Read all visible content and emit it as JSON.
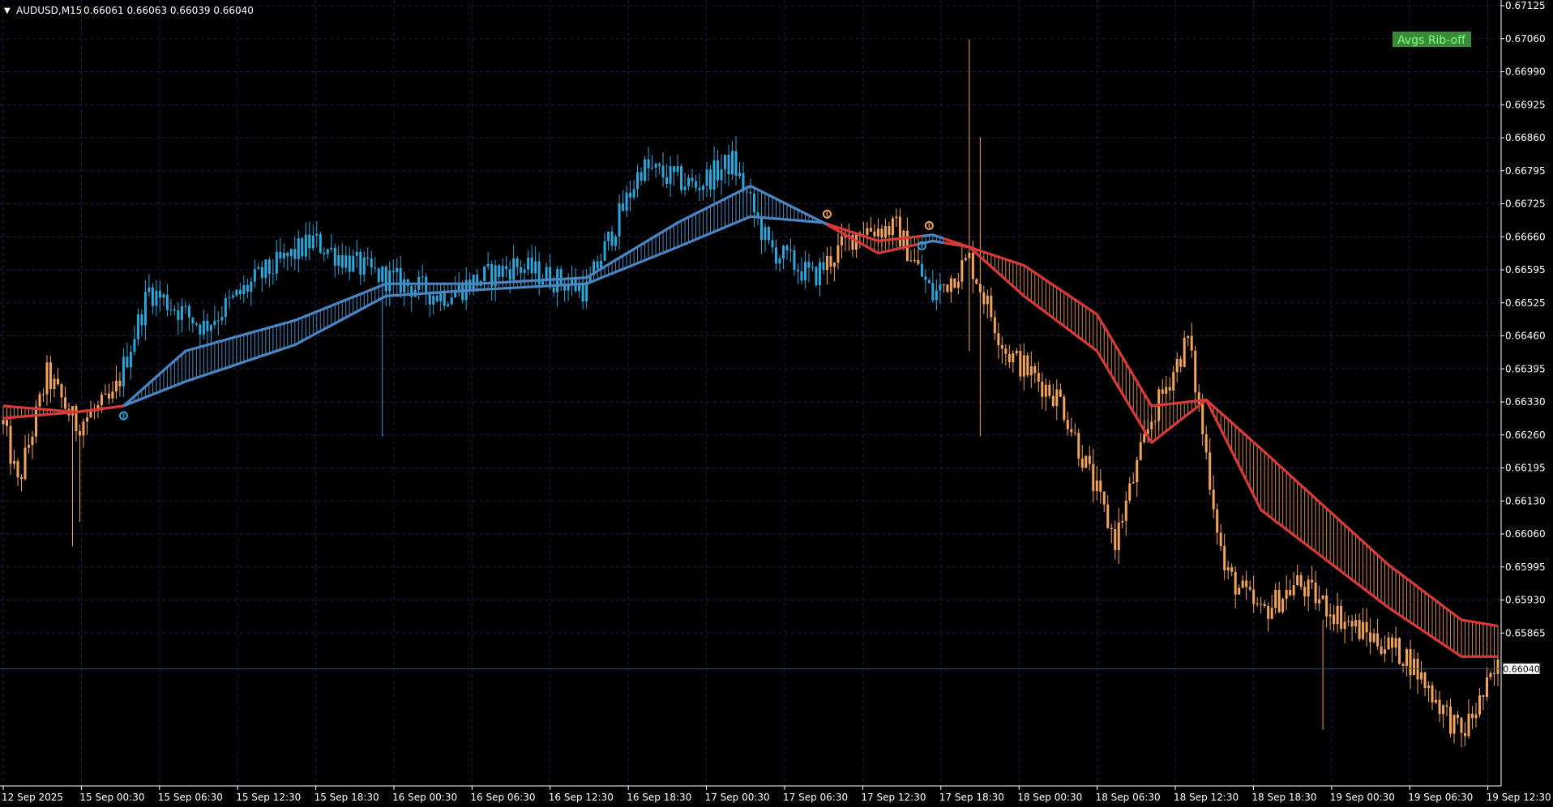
{
  "header": {
    "symbol_label": "AUDUSD,M15",
    "ohlc_label": "0.66061 0.66063 0.66039 0.66040"
  },
  "button": {
    "label": "Avgs Rib-off"
  },
  "colors": {
    "background": "#000000",
    "grid": "#1c1c4f",
    "axis": "#ffffff",
    "up": "#2ca7dc",
    "down": "#f2a45a",
    "ma_up": "#4a86c4",
    "ma_down": "#d83a3a",
    "ribbon_up": "#5aa0d6",
    "ribbon_down": "#f0a060",
    "button_bg": "#3a8a3a",
    "button_fg": "#80ff80"
  },
  "chart_data": {
    "type": "line",
    "title": "AUDUSD,M15",
    "ylim": [
      0.65835,
      0.67125
    ],
    "y_ticks": [
      "0.67125",
      "0.67060",
      "0.66990",
      "0.66925",
      "0.66860",
      "0.66795",
      "0.66725",
      "0.66660",
      "0.66595",
      "0.66525",
      "0.66460",
      "0.66395",
      "0.66330",
      "0.66260",
      "0.66195",
      "0.66130",
      "0.66060",
      "0.65995",
      "0.65930",
      "0.65865"
    ],
    "x_ticks": [
      "12 Sep 2025",
      "15 Sep 00:30",
      "15 Sep 06:30",
      "15 Sep 12:30",
      "15 Sep 18:30",
      "16 Sep 00:30",
      "16 Sep 06:30",
      "16 Sep 12:30",
      "16 Sep 18:30",
      "17 Sep 00:30",
      "17 Sep 06:30",
      "17 Sep 12:30",
      "17 Sep 18:30",
      "18 Sep 00:30",
      "18 Sep 06:30",
      "18 Sep 12:30",
      "18 Sep 18:30",
      "19 Sep 00:30",
      "19 Sep 06:30",
      "19 Sep 12:30"
    ],
    "current_price": "0.66040",
    "price_path": [
      {
        "bar": 0,
        "p": 0.6644
      },
      {
        "bar": 4,
        "p": 0.6634
      },
      {
        "bar": 12,
        "p": 0.6652
      },
      {
        "bar": 20,
        "p": 0.6644
      },
      {
        "bar": 30,
        "p": 0.6648
      },
      {
        "bar": 40,
        "p": 0.6666
      },
      {
        "bar": 55,
        "p": 0.666
      },
      {
        "bar": 70,
        "p": 0.6668
      },
      {
        "bar": 85,
        "p": 0.6674
      },
      {
        "bar": 100,
        "p": 0.6669
      },
      {
        "bar": 120,
        "p": 0.6665
      },
      {
        "bar": 140,
        "p": 0.667
      },
      {
        "bar": 160,
        "p": 0.6666
      },
      {
        "bar": 175,
        "p": 0.6686
      },
      {
        "bar": 190,
        "p": 0.6683
      },
      {
        "bar": 200,
        "p": 0.6687
      },
      {
        "bar": 210,
        "p": 0.6673
      },
      {
        "bar": 222,
        "p": 0.6668
      },
      {
        "bar": 235,
        "p": 0.6676
      },
      {
        "bar": 245,
        "p": 0.6676
      },
      {
        "bar": 255,
        "p": 0.6665
      },
      {
        "bar": 265,
        "p": 0.6671
      },
      {
        "bar": 275,
        "p": 0.6656
      },
      {
        "bar": 290,
        "p": 0.6648
      },
      {
        "bar": 305,
        "p": 0.6625
      },
      {
        "bar": 315,
        "p": 0.6645
      },
      {
        "bar": 325,
        "p": 0.6658
      },
      {
        "bar": 335,
        "p": 0.662
      },
      {
        "bar": 345,
        "p": 0.6613
      },
      {
        "bar": 355,
        "p": 0.6618
      },
      {
        "bar": 370,
        "p": 0.6611
      },
      {
        "bar": 385,
        "p": 0.6606
      },
      {
        "bar": 400,
        "p": 0.6593
      },
      {
        "bar": 410,
        "p": 0.6604
      }
    ],
    "fast_ma": [
      {
        "bar": 0,
        "p": 0.6647
      },
      {
        "bar": 20,
        "p": 0.6646
      },
      {
        "bar": 33,
        "p": 0.6647
      },
      {
        "bar": 50,
        "p": 0.6656
      },
      {
        "bar": 80,
        "p": 0.6661
      },
      {
        "bar": 105,
        "p": 0.6667
      },
      {
        "bar": 130,
        "p": 0.6667
      },
      {
        "bar": 160,
        "p": 0.6668
      },
      {
        "bar": 185,
        "p": 0.6677
      },
      {
        "bar": 205,
        "p": 0.6683
      },
      {
        "bar": 225,
        "p": 0.6677
      },
      {
        "bar": 240,
        "p": 0.6674
      },
      {
        "bar": 255,
        "p": 0.6675
      },
      {
        "bar": 265,
        "p": 0.6673
      },
      {
        "bar": 280,
        "p": 0.6665
      },
      {
        "bar": 300,
        "p": 0.6656
      },
      {
        "bar": 315,
        "p": 0.6641
      },
      {
        "bar": 330,
        "p": 0.6648
      },
      {
        "bar": 345,
        "p": 0.663
      },
      {
        "bar": 380,
        "p": 0.6614
      },
      {
        "bar": 400,
        "p": 0.6606
      },
      {
        "bar": 410,
        "p": 0.6606
      }
    ],
    "slow_ma": [
      {
        "bar": 0,
        "p": 0.6645
      },
      {
        "bar": 20,
        "p": 0.6646
      },
      {
        "bar": 33,
        "p": 0.6647
      },
      {
        "bar": 50,
        "p": 0.6651
      },
      {
        "bar": 80,
        "p": 0.6657
      },
      {
        "bar": 105,
        "p": 0.6665
      },
      {
        "bar": 130,
        "p": 0.6666
      },
      {
        "bar": 160,
        "p": 0.6667
      },
      {
        "bar": 185,
        "p": 0.6673
      },
      {
        "bar": 205,
        "p": 0.6678
      },
      {
        "bar": 225,
        "p": 0.6677
      },
      {
        "bar": 240,
        "p": 0.6672
      },
      {
        "bar": 255,
        "p": 0.6674
      },
      {
        "bar": 265,
        "p": 0.6673
      },
      {
        "bar": 280,
        "p": 0.667
      },
      {
        "bar": 300,
        "p": 0.6662
      },
      {
        "bar": 315,
        "p": 0.6647
      },
      {
        "bar": 330,
        "p": 0.6648
      },
      {
        "bar": 345,
        "p": 0.664
      },
      {
        "bar": 380,
        "p": 0.6621
      },
      {
        "bar": 400,
        "p": 0.6612
      },
      {
        "bar": 410,
        "p": 0.6611
      }
    ],
    "up_segments": [
      [
        33,
        225
      ],
      [
        252,
        257
      ]
    ],
    "bars_total": 411,
    "signals": [
      {
        "bar": 33,
        "type": "up"
      },
      {
        "bar": 226,
        "type": "down"
      },
      {
        "bar": 252,
        "type": "up"
      },
      {
        "bar": 254,
        "type": "down"
      }
    ],
    "spikes": [
      {
        "bar": 19,
        "high": 0.6647,
        "low": 0.6624
      },
      {
        "bar": 21,
        "high": 0.6644,
        "low": 0.6628
      },
      {
        "bar": 104,
        "high": 0.667,
        "low": 0.6642
      },
      {
        "bar": 265,
        "high": 0.6707,
        "low": 0.6656
      },
      {
        "bar": 268,
        "high": 0.6691,
        "low": 0.6642
      },
      {
        "bar": 362,
        "high": 0.6612,
        "low": 0.6594
      }
    ]
  }
}
